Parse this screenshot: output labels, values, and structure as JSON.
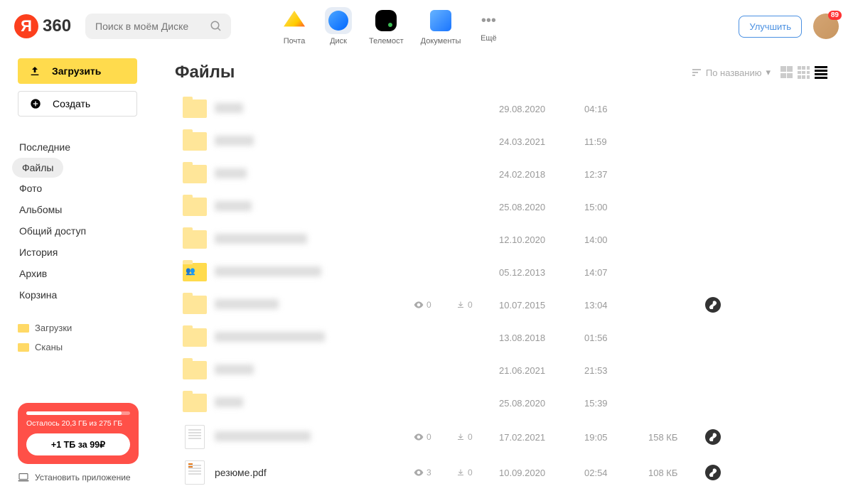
{
  "logo_text": "360",
  "search": {
    "placeholder": "Поиск в моём Диске"
  },
  "services": {
    "mail": "Почта",
    "disk": "Диск",
    "telemost": "Телемост",
    "documents": "Документы",
    "more": "Ещё"
  },
  "upgrade_label": "Улучшить",
  "avatar_badge": "89",
  "upload_label": "Загрузить",
  "create_label": "Создать",
  "nav": {
    "recent": "Последние",
    "files": "Файлы",
    "photo": "Фото",
    "albums": "Альбомы",
    "shared": "Общий доступ",
    "history": "История",
    "archive": "Архив",
    "trash": "Корзина"
  },
  "folders": {
    "downloads": "Загрузки",
    "scans": "Сканы"
  },
  "storage": {
    "remaining": "Осталось 20,3 ГБ из 275 ГБ",
    "cta": "+1 ТБ за 99₽"
  },
  "install_app": "Установить приложение",
  "page_title": "Файлы",
  "sort_label": "По названию",
  "files_list": [
    {
      "name": "",
      "date": "29.08.2020",
      "time": "04:16",
      "type": "folder",
      "nw": 40
    },
    {
      "name": "",
      "date": "24.03.2021",
      "time": "11:59",
      "type": "folder",
      "nw": 55
    },
    {
      "name": "",
      "date": "24.02.2018",
      "time": "12:37",
      "type": "folder",
      "nw": 45
    },
    {
      "name": "",
      "date": "25.08.2020",
      "time": "15:00",
      "type": "folder",
      "nw": 52
    },
    {
      "name": "",
      "date": "12.10.2020",
      "time": "14:00",
      "type": "folder",
      "nw": 130
    },
    {
      "name": "",
      "date": "05.12.2013",
      "time": "14:07",
      "type": "folder-shared",
      "nw": 150
    },
    {
      "name": "",
      "date": "10.07.2015",
      "time": "13:04",
      "type": "folder",
      "views": "0",
      "downloads": "0",
      "link": true,
      "nw": 90
    },
    {
      "name": "",
      "date": "13.08.2018",
      "time": "01:56",
      "type": "folder",
      "nw": 155
    },
    {
      "name": "",
      "date": "21.06.2021",
      "time": "21:53",
      "type": "folder",
      "nw": 55
    },
    {
      "name": "",
      "date": "25.08.2020",
      "time": "15:39",
      "type": "folder",
      "nw": 40
    },
    {
      "name": "",
      "date": "17.02.2021",
      "time": "19:05",
      "size": "158 КБ",
      "type": "doc",
      "views": "0",
      "downloads": "0",
      "link": true,
      "nw": 135
    },
    {
      "name": "резюме.pdf",
      "date": "10.09.2020",
      "time": "02:54",
      "size": "108 КБ",
      "type": "doc-color",
      "views": "3",
      "downloads": "0",
      "link": true
    }
  ]
}
